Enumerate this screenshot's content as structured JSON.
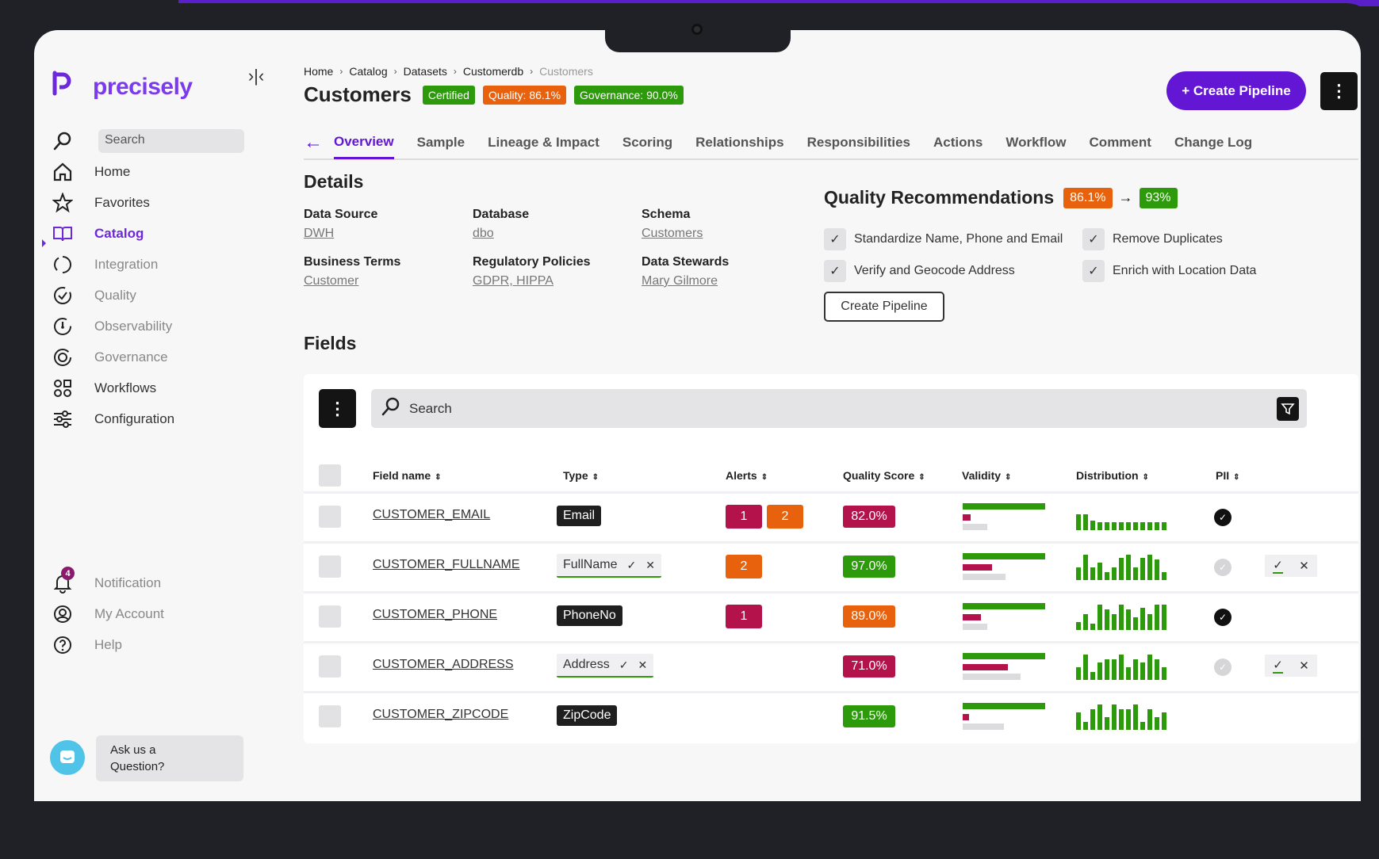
{
  "sidebar": {
    "brand": "precisely",
    "search_placeholder": "Search",
    "items": [
      {
        "label": "Home"
      },
      {
        "label": "Favorites"
      },
      {
        "label": "Catalog"
      },
      {
        "label": "Integration"
      },
      {
        "label": "Quality"
      },
      {
        "label": "Observability"
      },
      {
        "label": "Governance"
      },
      {
        "label": "Workflows"
      },
      {
        "label": "Configuration"
      }
    ],
    "bottom_items": [
      {
        "label": "Notification",
        "badge": "4"
      },
      {
        "label": "My Account"
      },
      {
        "label": "Help"
      }
    ],
    "ask_line1": "Ask us a",
    "ask_line2": "Question?"
  },
  "header": {
    "breadcrumb": [
      "Home",
      "Catalog",
      "Datasets",
      "Customerdb",
      "Customers"
    ],
    "title": "Customers",
    "badges": {
      "certified": "Certified",
      "quality": "Quality: 86.1%",
      "governance": "Governance: 90.0%"
    },
    "create_pipeline": "+ Create Pipeline"
  },
  "tabs": [
    "Overview",
    "Sample",
    "Lineage & Impact",
    "Scoring",
    "Relationships",
    "Responsibilities",
    "Actions",
    "Workflow",
    "Comment",
    "Change Log"
  ],
  "details": {
    "heading": "Details",
    "data_source_k": "Data Source",
    "data_source_v": "DWH",
    "database_k": "Database",
    "database_v": "dbo",
    "schema_k": "Schema",
    "schema_v": "Customers",
    "terms_k": "Business Terms",
    "terms_v": "Customer",
    "policies_k": "Regulatory Policies",
    "policies_v": "GDPR, HIPPA",
    "stewards_k": "Data Stewards",
    "stewards_v": "Mary Gilmore"
  },
  "quality_rec": {
    "heading": "Quality Recommendations",
    "from": "86.1%",
    "to": "93%",
    "items": [
      "Standardize Name, Phone and Email",
      "Remove Duplicates",
      "Verify and Geocode Address",
      "Enrich with Location Data"
    ],
    "button": "Create Pipeline"
  },
  "fields": {
    "heading": "Fields",
    "search_placeholder": "Search",
    "columns": [
      "Field name",
      "Type",
      "Alerts",
      "Quality Score",
      "Validity",
      "Distribution",
      "PII"
    ],
    "rows": [
      {
        "name": "CUSTOMER_EMAIL",
        "type": "Email",
        "type_editable": false,
        "alerts": [
          "1",
          "2"
        ],
        "quality": "82.0%",
        "quality_color": "#b3124a",
        "validity": [
          1.0,
          0.1,
          0.3
        ],
        "dist": [
          20,
          20,
          12,
          10,
          10,
          10,
          10,
          10,
          10,
          10,
          10,
          10,
          10
        ],
        "pii": "on"
      },
      {
        "name": "CUSTOMER_FULLNAME",
        "type": "FullName",
        "type_editable": true,
        "alerts": [
          "2"
        ],
        "quality": "97.0%",
        "quality_color": "#2c9a0a",
        "validity": [
          1.0,
          0.36,
          0.52
        ],
        "dist": [
          16,
          32,
          16,
          22,
          10,
          16,
          28,
          32,
          16,
          28,
          32,
          26,
          10
        ],
        "pii": "suggested"
      },
      {
        "name": "CUSTOMER_PHONE",
        "type": "PhoneNo",
        "type_editable": false,
        "alerts": [
          "1"
        ],
        "quality": "89.0%",
        "quality_color": "#e8620e",
        "validity": [
          1.0,
          0.22,
          0.3
        ],
        "dist": [
          10,
          20,
          8,
          32,
          26,
          20,
          32,
          26,
          16,
          28,
          20,
          32,
          32
        ],
        "pii": "on"
      },
      {
        "name": "CUSTOMER_ADDRESS",
        "type": "Address",
        "type_editable": true,
        "alerts": [],
        "quality": "71.0%",
        "quality_color": "#b3124a",
        "validity": [
          1.0,
          0.55,
          0.7
        ],
        "dist": [
          16,
          32,
          10,
          22,
          26,
          26,
          32,
          16,
          26,
          22,
          32,
          26,
          16
        ],
        "pii": "suggested"
      },
      {
        "name": "CUSTOMER_ZIPCODE",
        "type": "ZipCode",
        "type_editable": false,
        "alerts": [],
        "quality": "91.5%",
        "quality_color": "#2c9a0a",
        "validity": [
          1.0,
          0.08,
          0.5
        ],
        "dist": [
          22,
          10,
          26,
          32,
          16,
          32,
          26,
          26,
          32,
          10,
          26,
          16,
          22
        ],
        "pii": "none"
      }
    ]
  }
}
